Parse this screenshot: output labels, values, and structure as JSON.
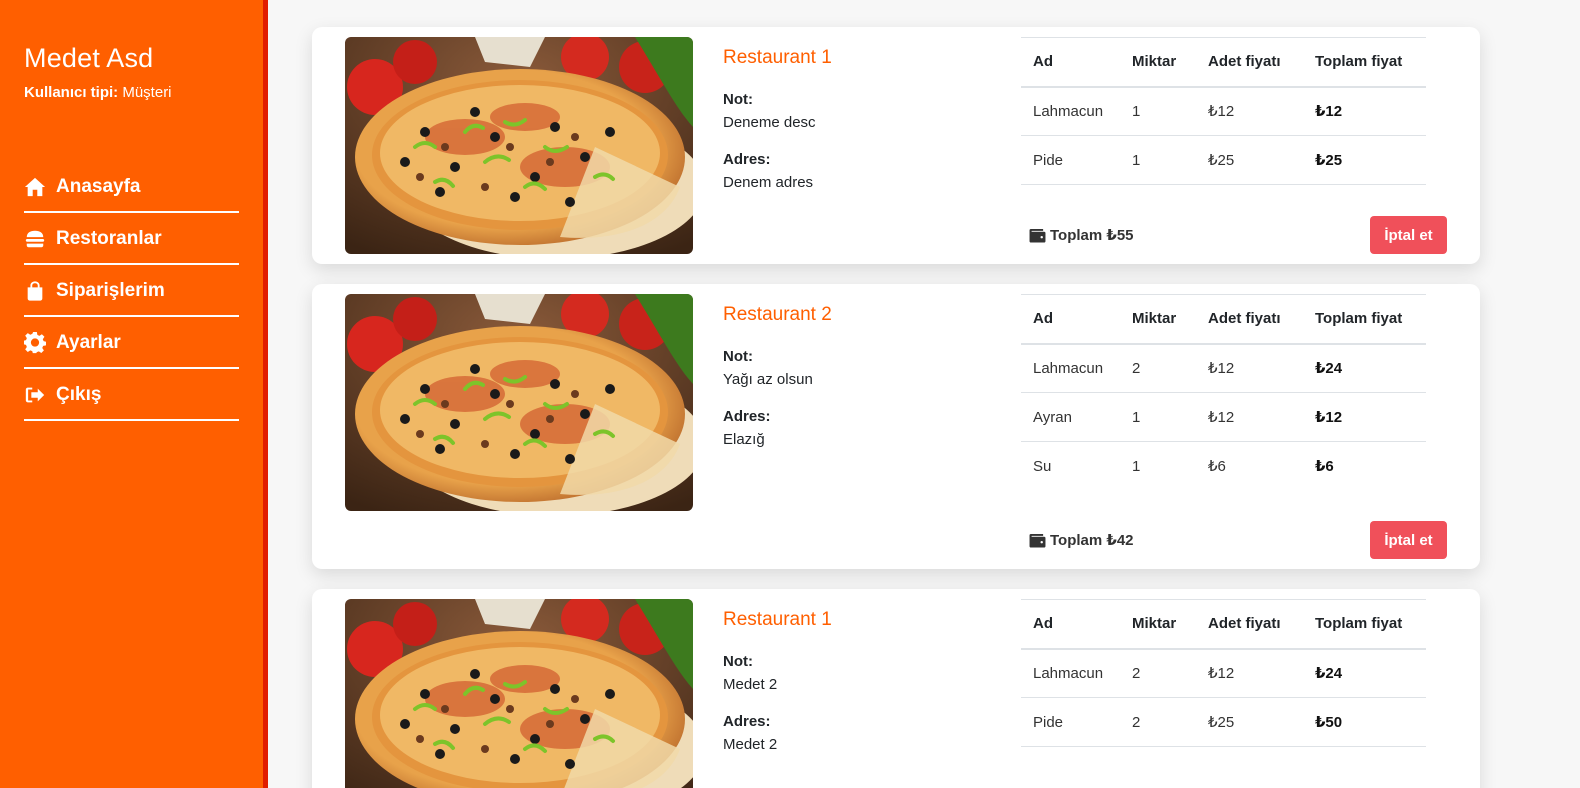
{
  "user": {
    "name": "Medet Asd",
    "type_label": "Kullanıcı tipi:",
    "type_value": "Müşteri"
  },
  "nav": [
    {
      "label": "Anasayfa",
      "icon": "home-icon"
    },
    {
      "label": "Restoranlar",
      "icon": "burger-icon"
    },
    {
      "label": "Siparişlerim",
      "icon": "shopping-bag-icon"
    },
    {
      "label": "Ayarlar",
      "icon": "gear-icon"
    },
    {
      "label": "Çıkış",
      "icon": "sign-out-icon"
    }
  ],
  "labels": {
    "note": "Not:",
    "address": "Adres:",
    "cancel": "İptal et",
    "total_prefix": "Toplam"
  },
  "table_headers": [
    "Ad",
    "Miktar",
    "Adet fiyatı",
    "Toplam fiyat"
  ],
  "orders": [
    {
      "restaurant": "Restaurant 1",
      "note": "Deneme desc",
      "address": "Denem adres",
      "items": [
        {
          "name": "Lahmacun",
          "qty": "1",
          "unit": "₺12",
          "total": "₺12"
        },
        {
          "name": "Pide",
          "qty": "1",
          "unit": "₺25",
          "total": "₺25"
        }
      ],
      "grand_total": "Toplam ₺55"
    },
    {
      "restaurant": "Restaurant 2",
      "note": "Yağı az olsun",
      "address": "Elazığ",
      "items": [
        {
          "name": "Lahmacun",
          "qty": "2",
          "unit": "₺12",
          "total": "₺24"
        },
        {
          "name": "Ayran",
          "qty": "1",
          "unit": "₺12",
          "total": "₺12"
        },
        {
          "name": "Su",
          "qty": "1",
          "unit": "₺6",
          "total": "₺6"
        }
      ],
      "grand_total": "Toplam ₺42"
    },
    {
      "restaurant": "Restaurant 1",
      "note": "Medet 2",
      "address": "Medet 2",
      "items": [
        {
          "name": "Lahmacun",
          "qty": "2",
          "unit": "₺12",
          "total": "₺24"
        },
        {
          "name": "Pide",
          "qty": "2",
          "unit": "₺25",
          "total": "₺50"
        }
      ],
      "grand_total": ""
    }
  ],
  "colors": {
    "accent": "#ff5f00",
    "sidebar_edge": "#e11d00",
    "cancel": "#f0505a"
  }
}
